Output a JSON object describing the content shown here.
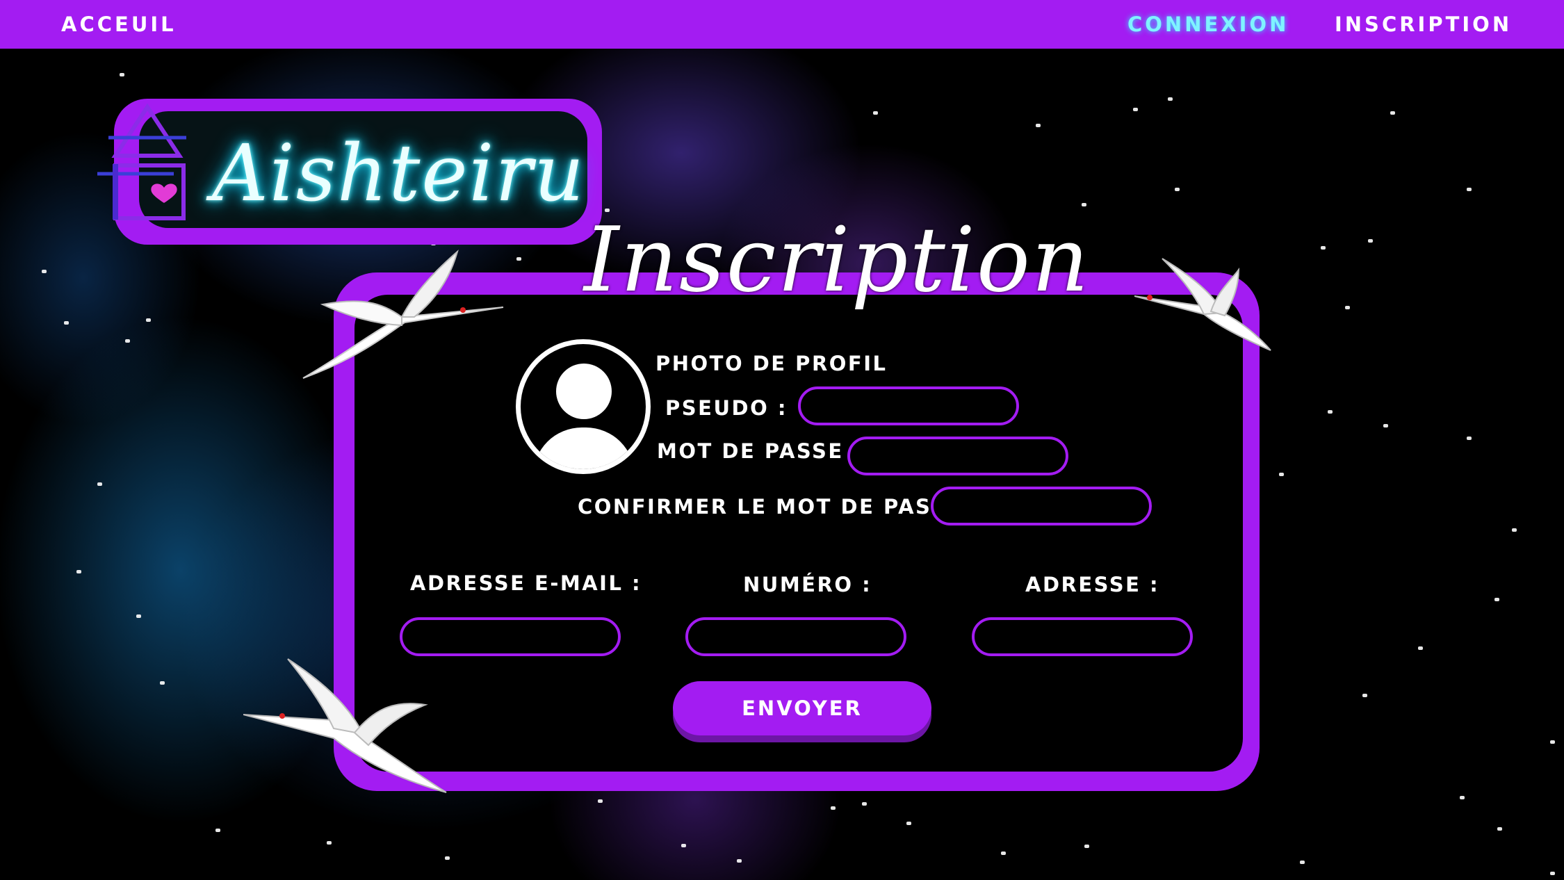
{
  "nav": {
    "home": "ACCEUIL",
    "login": "CONNEXION",
    "signup": "INSCRIPTION"
  },
  "logo": {
    "text": "Aishteiru"
  },
  "page": {
    "heading": "Inscription"
  },
  "form": {
    "profile_photo_label": "PHOTO DE PROFIL",
    "username_label": "PSEUDO :",
    "username_value": "",
    "password_label": "MOT DE PASSE",
    "password_value": "",
    "confirm_password_label": "CONFIRMER LE MOT DE PASSE",
    "confirm_password_value": "",
    "email_label": "ADRESSE E-MAIL :",
    "email_value": "",
    "phone_label": "NUMÉRO :",
    "phone_value": "",
    "address_label": "ADRESSE :",
    "address_value": "",
    "submit_label": "ENVOYER"
  },
  "icons": {
    "logo": "house-heart-icon",
    "avatar": "user-avatar-icon",
    "decoration": "crane-icon"
  },
  "colors": {
    "accent": "#a31cf2",
    "active_nav": "#7ff3ff",
    "background": "#000000",
    "neon_text": "#1fe4ff"
  }
}
